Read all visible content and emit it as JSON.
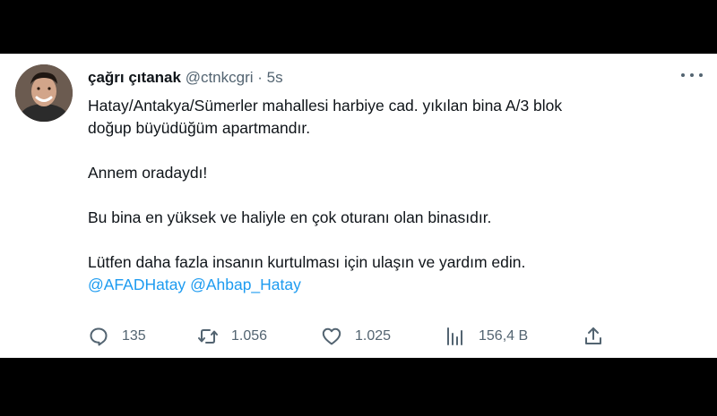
{
  "tweet": {
    "author_name": "çağrı çıtanak",
    "handle": "@ctnkcgri",
    "separator": "·",
    "time": "5s",
    "line1": "Hatay/Antakya/Sümerler mahallesi harbiye cad. yıkılan bina A/3 blok",
    "line2": "doğup büyüdüğüm apartmandır.",
    "line3": "Annem oradaydı!",
    "line4": "Bu bina en yüksek ve haliyle en çok oturanı olan binasıdır.",
    "line5": "Lütfen daha fazla insanın kurtulması için ulaşın ve yardım edin.",
    "mention1": "@AFADHatay",
    "mention2": "@Ahbap_Hatay"
  },
  "actions": {
    "replies": "135",
    "retweets": "1.056",
    "likes": "1.025",
    "views": "156,4 B"
  },
  "icons": {
    "more": "more-horizontal-icon",
    "reply": "reply-icon",
    "retweet": "retweet-icon",
    "like": "heart-icon",
    "views": "views-icon",
    "share": "share-icon"
  },
  "colors": {
    "text": "#0f1419",
    "secondary": "#536471",
    "link": "#1d9bf0",
    "background": "#ffffff",
    "frame": "#000000"
  }
}
